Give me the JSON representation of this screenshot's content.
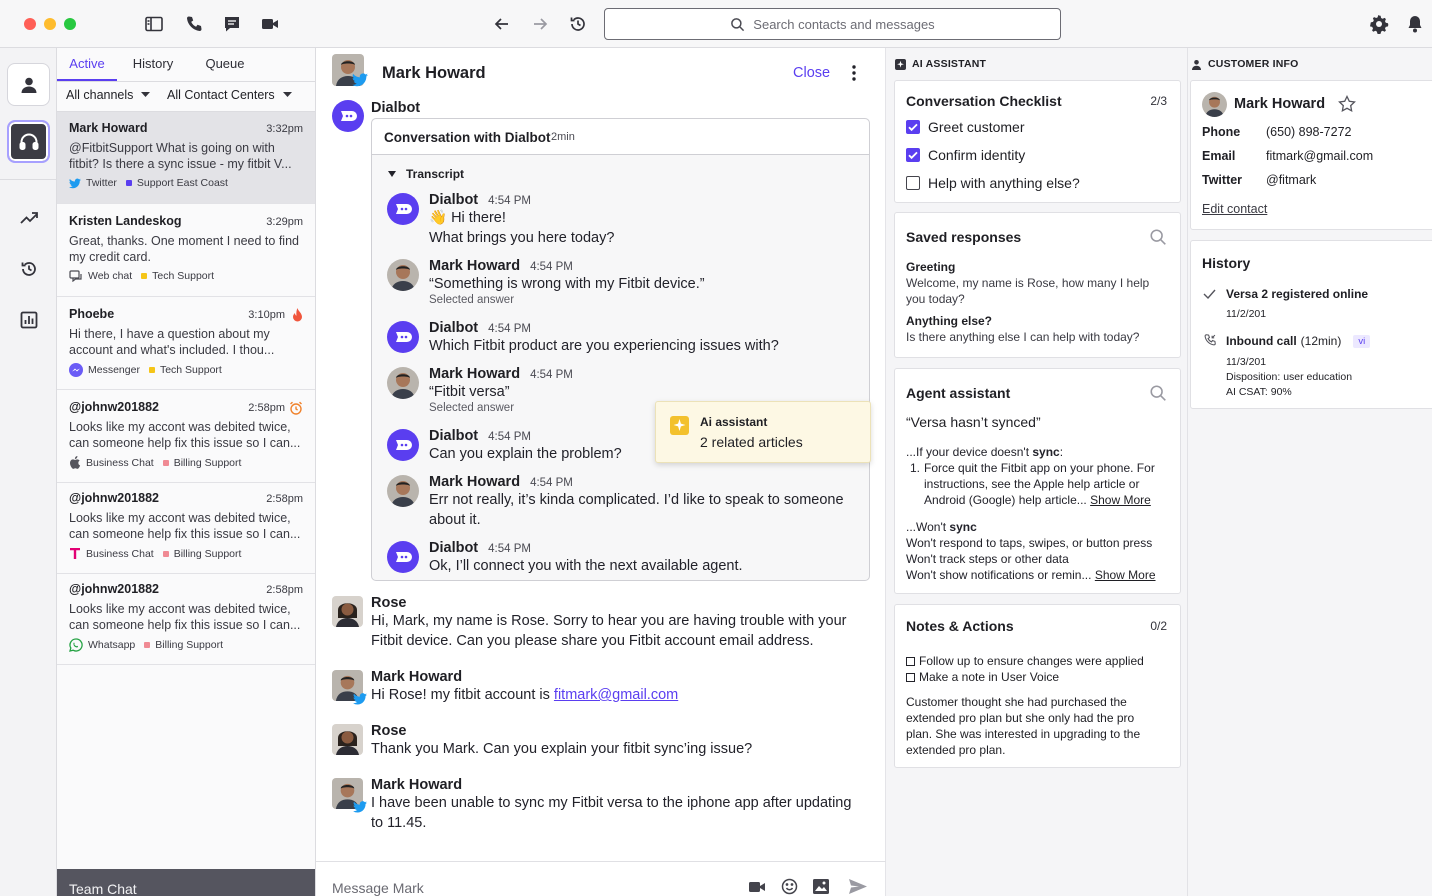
{
  "search": {
    "placeholder": "Search contacts and messages"
  },
  "list": {
    "tabs": [
      "Active",
      "History",
      "Queue"
    ],
    "filters": {
      "channels": "All channels",
      "centers": "All Contact Centers"
    },
    "conversations": [
      {
        "name": "Mark Howard",
        "time": "3:32pm",
        "preview": "@FitbitSupport What is going on with fitbit? Is there a sync issue - my fitbit V...",
        "channel": "Twitter",
        "queue": "Support East Coast",
        "queue_color": "#5a3ef0"
      },
      {
        "name": "Kristen Landeskog",
        "time": "3:29pm",
        "preview": "Great, thanks. One moment I need to find my credit card.",
        "channel": "Web chat",
        "queue": "Tech Support",
        "queue_color": "#f5c518"
      },
      {
        "name": "Phoebe",
        "time": "3:10pm",
        "preview": "Hi there, I have a question about my account and what's included. I thou...",
        "channel": "Messenger",
        "queue": "Tech Support",
        "queue_color": "#f5c518"
      },
      {
        "name": "@johnw201882",
        "time": "2:58pm",
        "preview": "Looks like my accont was debited twice, can someone help fix this issue so I can...",
        "channel": "Business Chat",
        "queue": "Billing Support",
        "queue_color": "#f08a94"
      },
      {
        "name": "@johnw201882",
        "time": "2:58pm",
        "preview": "Looks like my accont was debited twice, can someone help fix this issue so I can...",
        "channel": "Business Chat",
        "queue": "Billing Support",
        "queue_color": "#f08a94"
      },
      {
        "name": "@johnw201882",
        "time": "2:58pm",
        "preview": "Looks like my accont was debited twice, can someone help fix this issue so I can...",
        "channel": "Whatsapp",
        "queue": "Billing Support",
        "queue_color": "#f08a94"
      }
    ],
    "team_chat": "Team Chat"
  },
  "chat": {
    "contact_name": "Mark Howard",
    "close_label": "Close",
    "dialbot": {
      "label": "Dialbot",
      "header": "Conversation with Dialbot",
      "duration": "2min",
      "transcript_label": "Transcript",
      "messages": [
        {
          "from": "Dialbot",
          "time": "4:54 PM",
          "lines": [
            "👋 Hi there!",
            "What brings you here today?"
          ],
          "note": ""
        },
        {
          "from": "Mark Howard",
          "time": "4:54 PM",
          "lines": [
            "“Something is wrong with my Fitbit device.”"
          ],
          "note": "Selected answer"
        },
        {
          "from": "Dialbot",
          "time": "4:54 PM",
          "lines": [
            "Which Fitbit product are you experiencing issues with?"
          ],
          "note": ""
        },
        {
          "from": "Mark Howard",
          "time": "4:54 PM",
          "lines": [
            "“Fitbit versa”"
          ],
          "note": "Selected answer"
        },
        {
          "from": "Dialbot",
          "time": "4:54 PM",
          "lines": [
            "Can you explain the problem?"
          ],
          "note": ""
        },
        {
          "from": "Mark Howard",
          "time": "4:54 PM",
          "lines": [
            "Err not really, it’s kinda complicated. I’d like to speak to someone",
            "about it."
          ],
          "note": ""
        },
        {
          "from": "Dialbot",
          "time": "4:54 PM",
          "lines": [
            "Ok, I’ll connect you with the next available agent."
          ],
          "note": ""
        }
      ]
    },
    "ai_popup": {
      "title": "Ai assistant",
      "text": "2 related articles"
    },
    "messages": [
      {
        "from": "Rose",
        "lines": [
          "Hi, Mark, my name is Rose. Sorry to hear you are having trouble with your",
          "Fitbit device. Can you please share you Fitbit account email address."
        ]
      },
      {
        "from": "Mark Howard",
        "prefix": "Hi Rose! my fitbit account is ",
        "link": "fitmark@gmail.com"
      },
      {
        "from": "Rose",
        "lines": [
          "Thank you Mark. Can you explain your fitbit sync’ing issue?"
        ]
      },
      {
        "from": "Mark Howard",
        "lines": [
          "I have been unable to sync my Fitbit versa to the iphone app after updating",
          "to 11.45."
        ]
      }
    ],
    "composer_placeholder": "Message Mark"
  },
  "ai_panel": {
    "heading": "AI ASSISTANT",
    "checklist": {
      "title": "Conversation Checklist",
      "count": "2/3",
      "items": [
        {
          "label": "Greet customer",
          "checked": true
        },
        {
          "label": "Confirm identity",
          "checked": true
        },
        {
          "label": "Help with anything else?",
          "checked": false
        }
      ]
    },
    "saved": {
      "title": "Saved responses",
      "items": [
        {
          "title": "Greeting",
          "text": "Welcome, my name is Rose, how many I help you today?"
        },
        {
          "title": "Anything else?",
          "text": "Is there anything else I can help with today?"
        }
      ]
    },
    "agent": {
      "title": "Agent assistant",
      "query": "“Versa hasn’t synced”",
      "a1_intro": "...If your device doesn't ",
      "a1_bold": "sync",
      "a1_item": "Force quit the Fitbit app on your phone. For instructions, see the Apple help article or Android (Google) help article...",
      "show_more": "Show More",
      "a2_intro": "...Won't ",
      "a2_bold": "sync",
      "a2_lines": [
        "Won't respond to taps, swipes, or button press",
        "Won't track steps or other data",
        "Won't show notifications or remin..."
      ]
    },
    "notes": {
      "title": "Notes & Actions",
      "count": "0/2",
      "actions": [
        "Follow up to ensure changes were applied",
        "Make a note in User Voice"
      ],
      "text": "Customer thought she had purchased the extended pro plan but she only had the pro plan. She was interested in upgrading to the extended pro plan."
    }
  },
  "customer": {
    "heading": "CUSTOMER INFO",
    "name": "Mark Howard",
    "fields": [
      {
        "label": "Phone",
        "value": "(650) 898-7272"
      },
      {
        "label": "Email",
        "value": "fitmark@gmail.com"
      },
      {
        "label": "Twitter",
        "value": "@fitmark"
      }
    ],
    "edit": "Edit contact",
    "history": {
      "title": "History",
      "items": [
        {
          "title": "Versa 2 registered online",
          "date": "11/2/201"
        },
        {
          "title": "Inbound call",
          "extra": "(12min)",
          "tag": "vi",
          "date": "11/3/201",
          "details": [
            "Disposition: user education",
            "AI CSAT: 90%"
          ]
        }
      ]
    }
  },
  "colors": {
    "accent": "#5a3ef0",
    "twitter": "#1d9bf0",
    "selected_row": "#e3e3e7"
  }
}
